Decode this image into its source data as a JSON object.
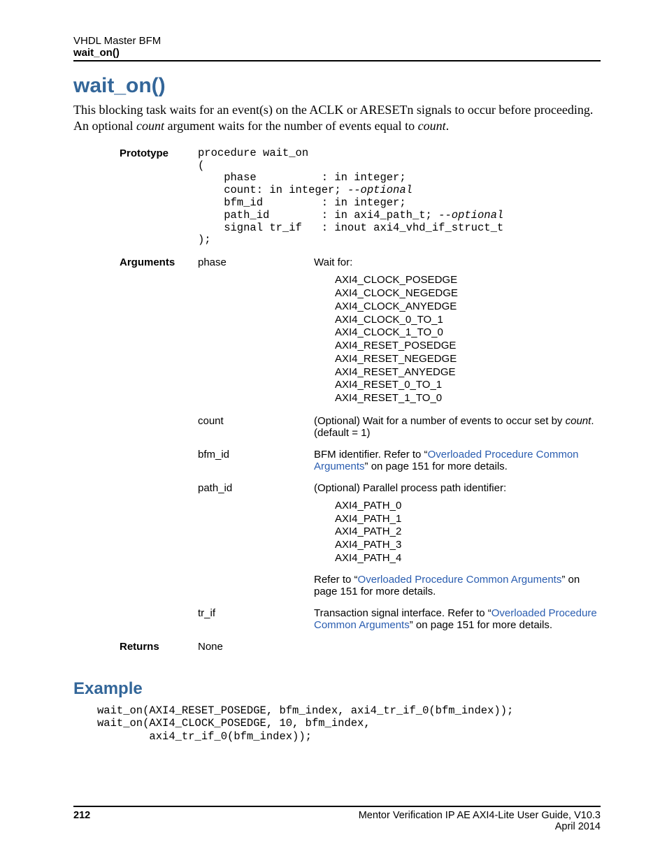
{
  "header": {
    "line1": "VHDL Master BFM",
    "line2": "wait_on()"
  },
  "title": "wait_on()",
  "intro": {
    "pre": "This blocking task waits for an event(s) on the ACLK or ARESETn signals to occur before proceeding. An optional ",
    "em1": "count",
    "mid": " argument waits for the number of events equal to ",
    "em2": "count",
    "post": "."
  },
  "prototype": {
    "label": "Prototype",
    "code_l1": "procedure wait_on",
    "code_l2": "(",
    "code_l3": "    phase          : in integer;",
    "code_l4a": "    count: in integer; ",
    "code_l4b": "--optional",
    "code_l5": "    bfm_id         : in integer;",
    "code_l6a": "    path_id        : in axi4_path_t; ",
    "code_l6b": "--optional",
    "code_l7": "    signal tr_if   : inout axi4_vhd_if_struct_t",
    "code_l8": ");"
  },
  "arguments": {
    "label": "Arguments",
    "rows": {
      "phase": {
        "name": "phase",
        "pre": "Wait for:",
        "enums": [
          "AXI4_CLOCK_POSEDGE",
          "AXI4_CLOCK_NEGEDGE",
          "AXI4_CLOCK_ANYEDGE",
          "AXI4_CLOCK_0_TO_1",
          "AXI4_CLOCK_1_TO_0",
          "AXI4_RESET_POSEDGE",
          "AXI4_RESET_NEGEDGE",
          "AXI4_RESET_ANYEDGE",
          "AXI4_RESET_0_TO_1",
          "AXI4_RESET_1_TO_0"
        ]
      },
      "count": {
        "name": "count",
        "pre": "(Optional) Wait for a number of events to occur set by ",
        "em": "count",
        "post": ". (default = 1)"
      },
      "bfm_id": {
        "name": "bfm_id",
        "pre": "BFM identifier. Refer to “",
        "link": "Overloaded Procedure Common Arguments",
        "post": "” on page 151 for more details."
      },
      "path_id": {
        "name": "path_id",
        "pre": "(Optional) Parallel process path identifier:",
        "enums": [
          "AXI4_PATH_0",
          "AXI4_PATH_1",
          "AXI4_PATH_2",
          "AXI4_PATH_3",
          "AXI4_PATH_4"
        ],
        "post_pre": "Refer to “",
        "post_link": "Overloaded Procedure Common Arguments",
        "post_post": "” on page 151 for more details."
      },
      "tr_if": {
        "name": "tr_if",
        "pre": "Transaction signal interface. Refer to “",
        "link": "Overloaded Procedure Common Arguments",
        "post": "” on page 151 for more details."
      }
    }
  },
  "returns": {
    "label": "Returns",
    "value": "None"
  },
  "example": {
    "label": "Example",
    "l1": "wait_on(AXI4_RESET_POSEDGE, bfm_index, axi4_tr_if_0(bfm_index));",
    "l2": "wait_on(AXI4_CLOCK_POSEDGE, 10, bfm_index,",
    "l3": "        axi4_tr_if_0(bfm_index));"
  },
  "footer": {
    "page": "212",
    "line1": "Mentor Verification IP AE AXI4-Lite User Guide, V10.3",
    "line2": "April 2014"
  }
}
